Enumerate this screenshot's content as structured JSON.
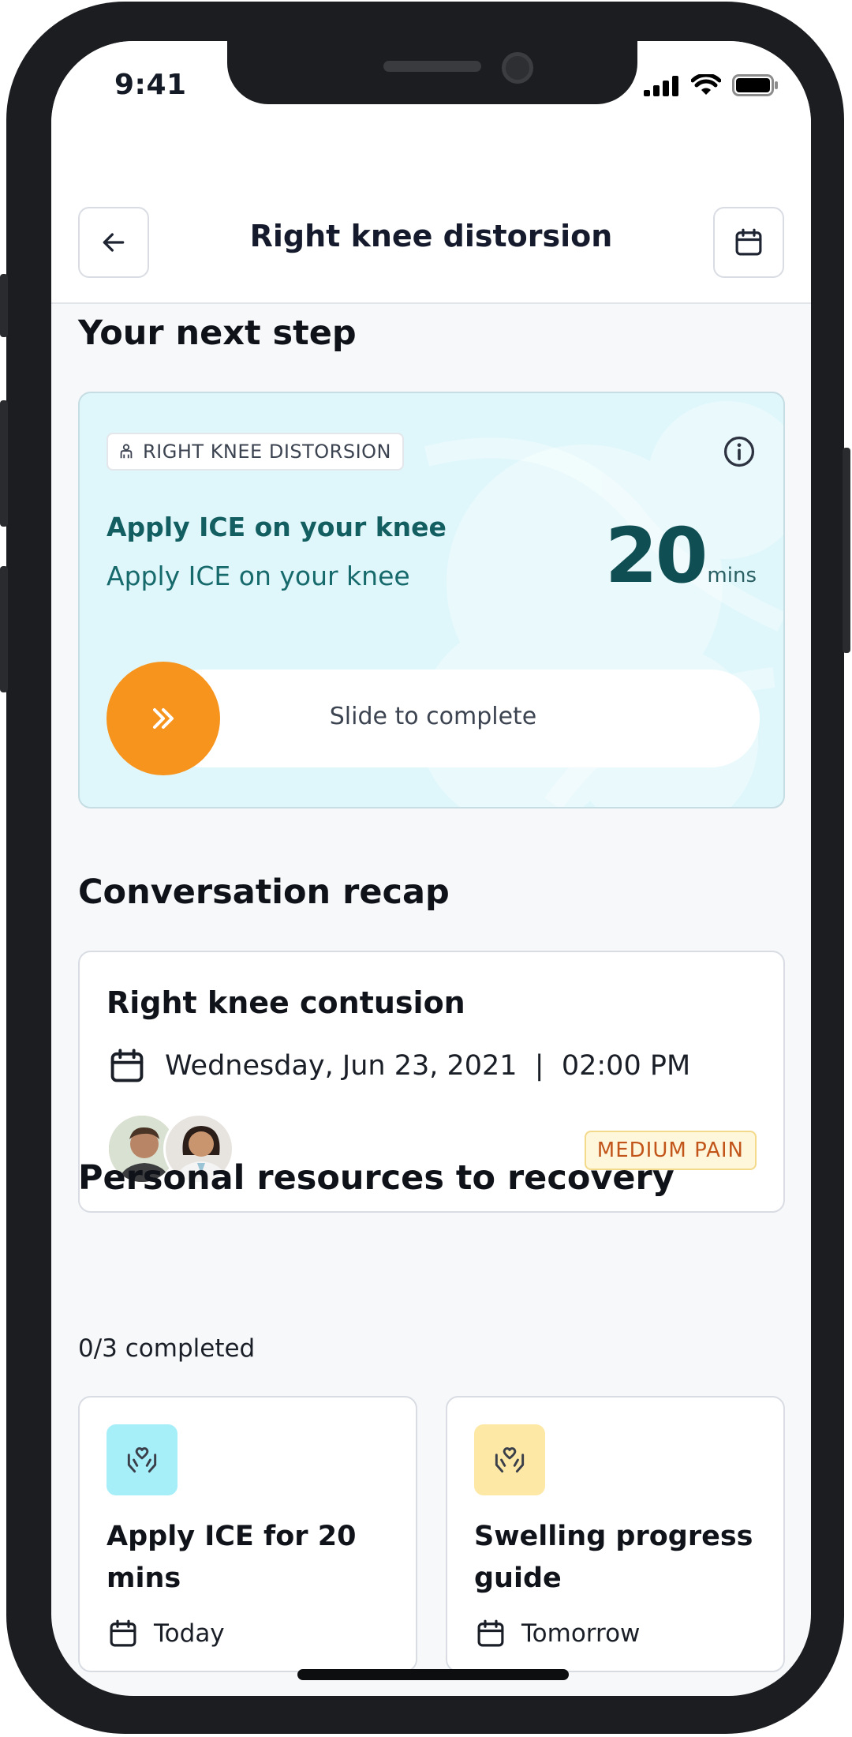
{
  "status_bar": {
    "time": "9:41"
  },
  "header": {
    "title": "Right knee distorsion"
  },
  "next_step": {
    "section_title": "Your next step",
    "tag": "RIGHT KNEE DISTORSION",
    "title": "Apply ICE on your knee",
    "subtitle": "Apply ICE on your knee",
    "duration_value": "20",
    "duration_unit": "mins",
    "slider_label": "Slide to complete",
    "accent_color": "#f7941d",
    "card_color": "#dff7fb"
  },
  "recap": {
    "section_title": "Conversation recap",
    "title": "Right knee contusion",
    "date": "Wednesday, Jun 23, 2021  |  02:00 PM",
    "pain_level": "MEDIUM PAIN"
  },
  "resources": {
    "section_title": "Personal resources to recovery",
    "progress": "0/3 completed",
    "items": [
      {
        "title": "Apply ICE for 20 mins",
        "when": "Today",
        "icon": "hands-heart-icon",
        "icon_bg": "#a6eef8"
      },
      {
        "title": "Swelling progress guide",
        "when": "Tomorrow",
        "icon": "hands-heart-icon",
        "icon_bg": "#fde8a6"
      }
    ]
  }
}
